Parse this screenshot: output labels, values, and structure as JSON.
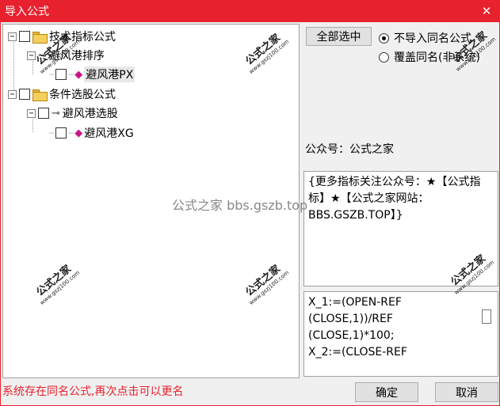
{
  "window": {
    "title": "导入公式"
  },
  "tree": {
    "items": [
      {
        "label": "技术指标公式"
      },
      {
        "label": "避风港排序"
      },
      {
        "label": "避风港PX"
      },
      {
        "label": "条件选股公式"
      },
      {
        "label": "避风港选股"
      },
      {
        "label": "避风港XG"
      }
    ]
  },
  "controls": {
    "select_all": "全部选中",
    "radio_skip": "不导入同名公式",
    "radio_overwrite": "覆盖同名(非系统)"
  },
  "info": {
    "label": "公众号：公式之家",
    "description": "{更多指标关注公众号：★【公式指标】★【公式之家网站：BBS.GSZB.TOP】}",
    "formula_lines": [
      "X_1:=(OPEN-REF",
      "(CLOSE,1))/REF",
      "(CLOSE,1)*100;",
      "X_2:=(CLOSE-REF"
    ]
  },
  "status": {
    "message": "系统存在同名公式,再次点击可以更名"
  },
  "buttons": {
    "ok": "确定",
    "cancel": "取消"
  },
  "watermarks": {
    "cn": "公式之家",
    "url": "www.gszj100.com",
    "center": "公式之家 bbs.gszb.top"
  },
  "colors": {
    "titlebar": "#e8212e",
    "status_text": "#e8212e",
    "gem": "#c71585"
  }
}
